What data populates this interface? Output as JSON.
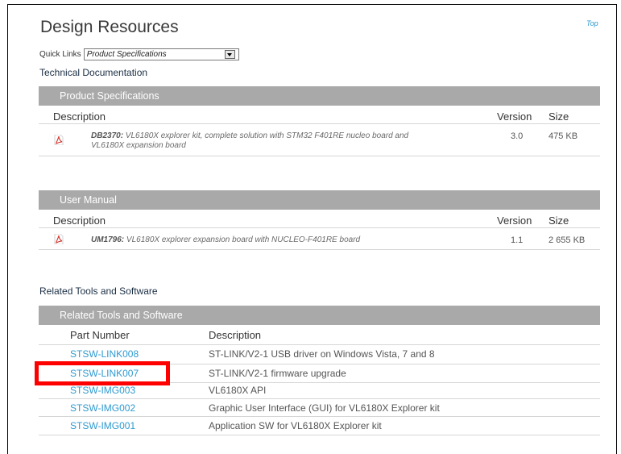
{
  "page": {
    "title": "Design Resources",
    "top_link": "Top",
    "quick_links": {
      "label": "Quick Links",
      "selected": "Product Specifications"
    },
    "technical_documentation": "Technical Documentation"
  },
  "product_specifications": {
    "header": "Product Specifications",
    "columns": {
      "description": "Description",
      "version": "Version",
      "size": "Size"
    },
    "rows": [
      {
        "code": "DB2370:",
        "text": " VL6180X explorer kit, complete solution with STM32 F401RE nucleo board and",
        "text2": "VL6180X expansion board",
        "version": "3.0",
        "size": "475 KB"
      }
    ]
  },
  "user_manual": {
    "header": "User Manual",
    "columns": {
      "description": "Description",
      "version": "Version",
      "size": "Size"
    },
    "rows": [
      {
        "code": "UM1796:",
        "text": " VL6180X explorer expansion board with NUCLEO-F401RE board",
        "version": "1.1",
        "size": "2 655 KB"
      }
    ]
  },
  "related": {
    "title": "Related Tools and Software",
    "header": "Related Tools and Software",
    "columns": {
      "part_number": "Part Number",
      "description": "Description"
    },
    "rows": [
      {
        "part": "STSW-LINK008",
        "desc": "ST-LINK/V2-1 USB driver on Windows Vista, 7 and 8"
      },
      {
        "part": "STSW-LINK007",
        "desc": "ST-LINK/V2-1 firmware upgrade"
      },
      {
        "part": "STSW-IMG003",
        "desc": "VL6180X API"
      },
      {
        "part": "STSW-IMG002",
        "desc": "Graphic User Interface (GUI) for VL6180X Explorer kit"
      },
      {
        "part": "STSW-IMG001",
        "desc": "Application SW for VL6180X Explorer kit"
      }
    ]
  },
  "colors": {
    "link": "#2e9ad0",
    "section_bar": "#a9a9a9",
    "highlight": "#ff0000",
    "pdf_red": "#d4302a"
  },
  "icons": {
    "document": "pdf-icon",
    "dropdown": "chevron-down-icon"
  }
}
